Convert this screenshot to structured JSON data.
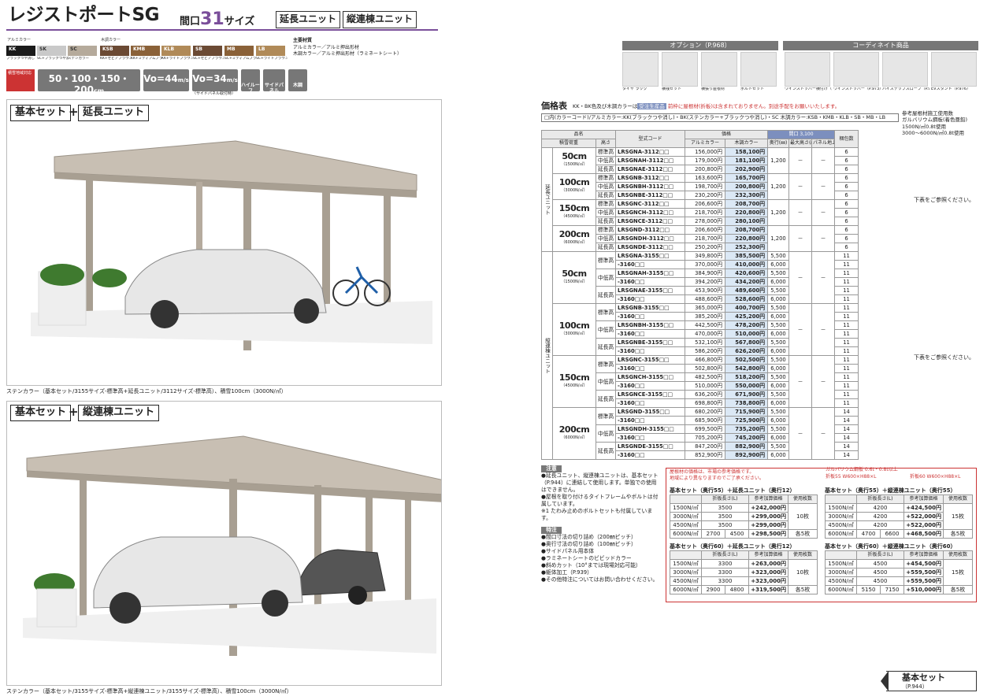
{
  "header": {
    "title": "レジストポートSG",
    "span_label": "間口",
    "span_num": "31",
    "span_unit": "サイズ",
    "tag1": "延長ユニット",
    "tag2": "縦連棟ユニット"
  },
  "swatches": {
    "alu_label": "アルミカラー",
    "wood_label": "木調カラー",
    "items": [
      {
        "code": "KK",
        "name": "ブラックつや消し",
        "color": "#1a1a1a",
        "text": "#fff"
      },
      {
        "code": "SK",
        "name": "SC+ブラックつや消し",
        "color": "#c9c9c9",
        "text": "#333"
      },
      {
        "code": "SC",
        "name": "ステンカラー",
        "color": "#b5aa9b",
        "text": "#333"
      },
      {
        "code": "KSB",
        "name": "KK+セピアブラウン",
        "color": "#6b4a34",
        "text": "#fff"
      },
      {
        "code": "KMB",
        "name": "KK+ミディアムブラウン",
        "color": "#8a6138",
        "text": "#fff"
      },
      {
        "code": "KLB",
        "name": "KK+ライトブラウン",
        "color": "#b08a58",
        "text": "#fff"
      },
      {
        "code": "SB",
        "name": "SC+セピアブラウン",
        "color": "#6b4a34",
        "text": "#fff"
      },
      {
        "code": "MB",
        "name": "SC+ミディアムブラウン",
        "color": "#8a6138",
        "text": "#fff"
      },
      {
        "code": "LB",
        "name": "SC+ライトブラウン",
        "color": "#b08a58",
        "text": "#fff"
      }
    ]
  },
  "materials": {
    "title": "主要材質",
    "line1": "アルミカラー／アルミ押出形材",
    "line2": "木調カラー／アルミ押出形材（ラミネートシート）"
  },
  "specs": {
    "badge": "積雪地域対応",
    "snow": "50・100・150・200",
    "snow_unit": "cm",
    "wind1": "Vo=44",
    "wind1_unit": "m/s",
    "wind2": "Vo=34",
    "wind2_unit": "m/s",
    "wind2_note": "（サイドパネル取付時）",
    "icon1": "ハイルーフ",
    "icon2": "サイドパネル",
    "icon3": "木調"
  },
  "panel1": {
    "label1": "基本セット",
    "plus": "+",
    "label2": "延長ユニット",
    "caption": "ステンカラー（基本セット/3155サイズ-標準高+延長ユニット/3112サイズ-標準高）、積雪100cm（3000N/㎡）"
  },
  "panel2": {
    "label1": "基本セット",
    "plus": "+",
    "label2": "縦連棟ユニット",
    "caption": "ステンカラー（基本セット/3155サイズ-標準高+縦連棟ユニット/3155サイズ-標準高）、積雪100cm（3000N/㎡）"
  },
  "options": {
    "title": "オプション（P.968）",
    "items": [
      "タイヤ ラック",
      "横桟セット",
      "横張り屋根材",
      "ボルトセット"
    ]
  },
  "coord": {
    "title": "コーディネイト商品",
    "items": [
      "ウインストッパー横付け（P.973）",
      "ウインストッパー（P.973）",
      "ハイステップスロープ（P.973）",
      "EVスタンド（P.976）"
    ]
  },
  "price": {
    "heading": "価格表",
    "note1": "KK・BK色及び木調カラーは",
    "note1b": "受注生産品",
    "note1c": "前枠に屋根材(折板)は含まれておりません。別途手配をお願いいたします。",
    "codes_line": "□内(カラーコード)/アルミカラー:KK(ブラックつや消し)・BK(ステンカラー+ブラックつや消し)・SC 木調カラー:KSB・KMB・KLB・SB・MB・LB",
    "h": {
      "name": "品名",
      "snow": "積雪荷重",
      "height": "高さ",
      "code": "型式コード",
      "price": "価格",
      "alu": "アルミカラー",
      "wood": "木調カラー",
      "span": "間口 3,100",
      "depth": "奥行(㎜)",
      "maxh": "最大高さ(㎜)",
      "panelh": "パネル地上高さ(㎜)",
      "bundle": "梱包数"
    },
    "side_ext": "延長ユニット",
    "side_con": "縦連棟ユニット",
    "ext": [
      {
        "snow": "50",
        "unit": "cm",
        "load": "（1500N/㎡）",
        "rows": [
          [
            "標準高",
            "LRSGNA-3112□□",
            "156,000円",
            "158,100円",
            "6"
          ],
          [
            "中低高",
            "LRSGNAH-3112□□",
            "179,000円",
            "181,100円",
            "6"
          ],
          [
            "延長高",
            "LRSGNAE-3112□□",
            "200,800円",
            "202,900円",
            "6"
          ]
        ]
      },
      {
        "snow": "100",
        "unit": "cm",
        "load": "（3000N/㎡）",
        "rows": [
          [
            "標準高",
            "LRSGNB-3112□□",
            "163,600円",
            "165,700円",
            "6"
          ],
          [
            "中低高",
            "LRSGNBH-3112□□",
            "198,700円",
            "200,800円",
            "6"
          ],
          [
            "延長高",
            "LRSGNBE-3112□□",
            "230,200円",
            "232,300円",
            "6"
          ]
        ]
      },
      {
        "snow": "150",
        "unit": "cm",
        "load": "（4500N/㎡）",
        "rows": [
          [
            "標準高",
            "LRSGNC-3112□□",
            "206,600円",
            "208,700円",
            "6"
          ],
          [
            "中低高",
            "LRSGNCH-3112□□",
            "218,700円",
            "220,800円",
            "6"
          ],
          [
            "延長高",
            "LRSGNCE-3112□□",
            "278,000円",
            "280,100円",
            "6"
          ]
        ]
      },
      {
        "snow": "200",
        "unit": "cm",
        "load": "（6000N/㎡）",
        "rows": [
          [
            "標準高",
            "LRSGND-3112□□",
            "206,600円",
            "208,700円",
            "6"
          ],
          [
            "中低高",
            "LRSGNDH-3112□□",
            "218,700円",
            "220,800円",
            "6"
          ],
          [
            "延長高",
            "LRSGNDE-3112□□",
            "250,200円",
            "252,300円",
            "6"
          ]
        ]
      }
    ],
    "ext_depth": "1,200",
    "dash": "－",
    "con": [
      {
        "snow": "50",
        "unit": "cm",
        "load": "（1500N/㎡）",
        "rows": [
          [
            "標準高",
            "LRSGNA-3155□□",
            "349,800円",
            "385,500円",
            "5,500",
            "11"
          ],
          [
            "",
            "-3160□□",
            "370,000円",
            "410,000円",
            "6,000",
            "11"
          ],
          [
            "中低高",
            "LRSGNAH-3155□□",
            "384,900円",
            "420,600円",
            "5,500",
            "11"
          ],
          [
            "",
            "-3160□□",
            "394,200円",
            "434,200円",
            "6,000",
            "11"
          ],
          [
            "延長高",
            "LRSGNAE-3155□□",
            "453,900円",
            "489,600円",
            "5,500",
            "11"
          ],
          [
            "",
            "-3160□□",
            "488,600円",
            "528,600円",
            "6,000",
            "11"
          ]
        ]
      },
      {
        "snow": "100",
        "unit": "cm",
        "load": "（3000N/㎡）",
        "rows": [
          [
            "標準高",
            "LRSGNB-3155□□",
            "365,000円",
            "400,700円",
            "5,500",
            "11"
          ],
          [
            "",
            "-3160□□",
            "385,200円",
            "425,200円",
            "6,000",
            "11"
          ],
          [
            "中低高",
            "LRSGNBH-3155□□",
            "442,500円",
            "478,200円",
            "5,500",
            "11"
          ],
          [
            "",
            "-3160□□",
            "470,000円",
            "510,000円",
            "6,000",
            "11"
          ],
          [
            "延長高",
            "LRSGNBE-3155□□",
            "532,100円",
            "567,800円",
            "5,500",
            "11"
          ],
          [
            "",
            "-3160□□",
            "586,200円",
            "626,200円",
            "6,000",
            "11"
          ]
        ]
      },
      {
        "snow": "150",
        "unit": "cm",
        "load": "（4500N/㎡）",
        "rows": [
          [
            "標準高",
            "LRSGNC-3155□□",
            "466,800円",
            "502,500円",
            "5,500",
            "11"
          ],
          [
            "",
            "-3160□□",
            "502,800円",
            "542,800円",
            "6,000",
            "11"
          ],
          [
            "中低高",
            "LRSGNCH-3155□□",
            "482,500円",
            "518,200円",
            "5,500",
            "11"
          ],
          [
            "",
            "-3160□□",
            "510,000円",
            "550,000円",
            "6,000",
            "11"
          ],
          [
            "延長高",
            "LRSGNCE-3155□□",
            "636,200円",
            "671,900円",
            "5,500",
            "11"
          ],
          [
            "",
            "-3160□□",
            "698,800円",
            "738,800円",
            "6,000",
            "11"
          ]
        ]
      },
      {
        "snow": "200",
        "unit": "cm",
        "load": "（6000N/㎡）",
        "rows": [
          [
            "標準高",
            "LRSGND-3155□□",
            "680,200円",
            "715,900円",
            "5,500",
            "14"
          ],
          [
            "",
            "-3160□□",
            "685,900円",
            "725,900円",
            "6,000",
            "14"
          ],
          [
            "中低高",
            "LRSGNDH-3155□□",
            "699,500円",
            "735,200円",
            "5,500",
            "14"
          ],
          [
            "",
            "-3160□□",
            "705,200円",
            "745,200円",
            "6,000",
            "14"
          ],
          [
            "延長高",
            "LRSGNDE-3155□□",
            "847,200円",
            "882,900円",
            "5,500",
            "14"
          ],
          [
            "",
            "-3160□□",
            "852,900円",
            "892,900円",
            "6,000",
            "14"
          ]
        ]
      }
    ]
  },
  "sidenote": {
    "title": "参考屋根材施工使用数",
    "text": "ガルバリウム鋼板(着色亜鉛)\n1500N/㎡0.8t使用\n3000～6000N/㎡0.8t使用",
    "below1": "下表をご参照ください。",
    "below2": "下表をご参照ください。"
  },
  "notes": {
    "title": "注意",
    "items": [
      "●延長ユニット、縦連棟ユニットは、基本セット（P.944）に連結して使用します。単独での使用はできません。",
      "●屋根を取り付けるタイトフレームやボルトは付属しています。",
      "※1 たわみ止めのボルトセットも付属しています。"
    ],
    "title2": "特注",
    "items2": [
      "●間口寸法の切り詰め（200㎜ピッチ）",
      "●奥行寸法の切り詰め（100㎜ピッチ）",
      "●サイドパネル用本体",
      "●ラミネートシートのビビッドカラー",
      "●斜めカット（10°までは現場対応可能）",
      "●躯体加工（P.939）",
      "●その他特注についてはお問い合わせください。"
    ]
  },
  "red_note": {
    "line1": "屋根材の価格は、市場の参考価格です。",
    "line2": "地域により異なりますのでご了承ください。",
    "line3": "ガルバリウム鋼板 0.6t・0.8t以上",
    "line4": "折板55 W600×H88×L",
    "line5": "折板60 W600×H88×L"
  },
  "sub": {
    "h": [
      "",
      "折板長さ(L)",
      "参考加算価格",
      "使用枚数"
    ],
    "t1": {
      "title": "基本セット（奥行55）＋延長ユニット（奥行12）",
      "rows": [
        [
          "1500N/㎡",
          "3500",
          "",
          "+242,000円"
        ],
        [
          "3000N/㎡",
          "3500",
          "",
          "+299,000円"
        ],
        [
          "4500N/㎡",
          "3500",
          "",
          "+299,000円"
        ],
        [
          "6000N/㎡",
          "2700",
          "4500",
          "+298,500円"
        ]
      ],
      "qty": "10枚",
      "qty2": "各5枚"
    },
    "t2": {
      "title": "基本セット（奥行55）＋縦連棟ユニット（奥行55）",
      "rows": [
        [
          "1500N/㎡",
          "4200",
          "",
          "+424,500円"
        ],
        [
          "3000N/㎡",
          "4200",
          "",
          "+522,000円"
        ],
        [
          "4500N/㎡",
          "4200",
          "",
          "+522,000円"
        ],
        [
          "6000N/㎡",
          "4700",
          "6600",
          "+468,500円"
        ]
      ],
      "qty": "15枚",
      "qty2": "各5枚"
    },
    "t3": {
      "title": "基本セット（奥行60）＋延長ユニット（奥行12）",
      "rows": [
        [
          "1500N/㎡",
          "3300",
          "",
          "+263,000円"
        ],
        [
          "3000N/㎡",
          "3300",
          "",
          "+323,000円"
        ],
        [
          "4500N/㎡",
          "3300",
          "",
          "+323,000円"
        ],
        [
          "6000N/㎡",
          "2900",
          "4800",
          "+319,500円"
        ]
      ],
      "qty": "10枚",
      "qty2": "各5枚"
    },
    "t4": {
      "title": "基本セット（奥行60）＋縦連棟ユニット（奥行60）",
      "rows": [
        [
          "1500N/㎡",
          "4500",
          "",
          "+454,500円"
        ],
        [
          "3000N/㎡",
          "4500",
          "",
          "+559,500円"
        ],
        [
          "4500N/㎡",
          "4500",
          "",
          "+559,500円"
        ],
        [
          "6000N/㎡",
          "5150",
          "7150",
          "+510,000円"
        ]
      ],
      "qty": "15枚",
      "qty2": "各5枚"
    }
  },
  "footer": {
    "label": "基本セット",
    "page": "（P.944）"
  }
}
